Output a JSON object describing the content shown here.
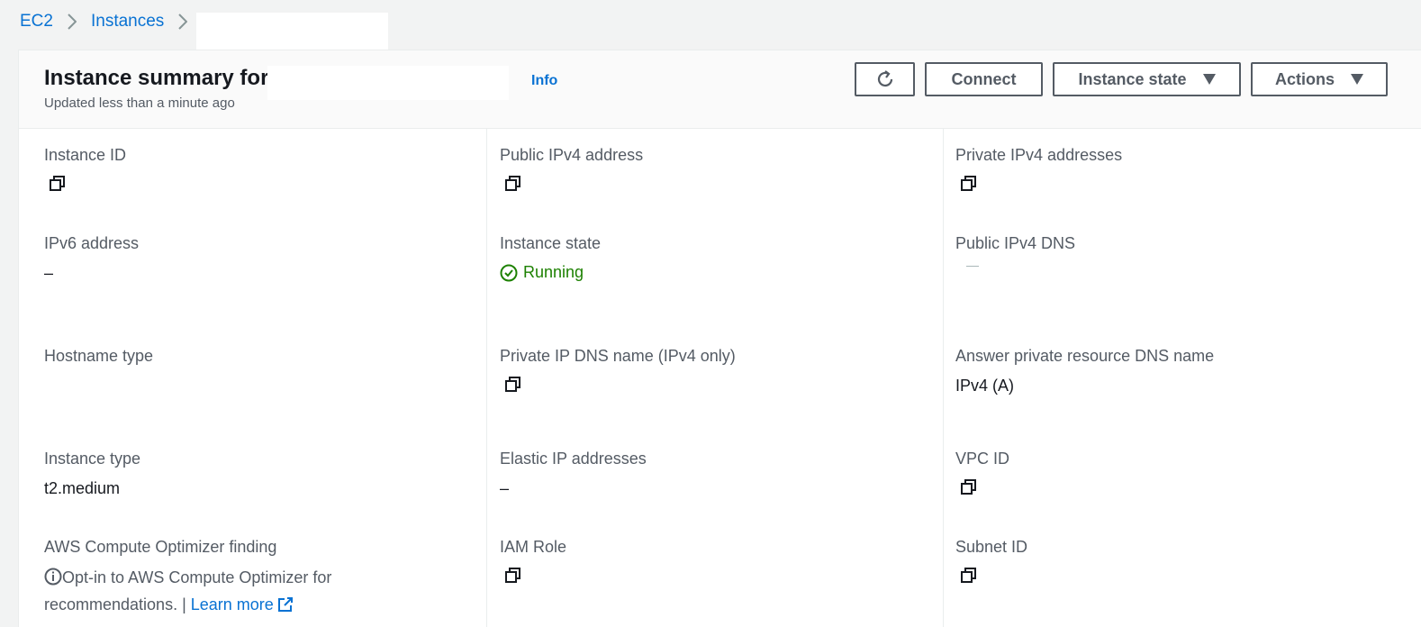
{
  "breadcrumb": {
    "items": [
      "EC2",
      "Instances"
    ]
  },
  "header": {
    "title": "Instance summary for",
    "info_label": "Info",
    "subtitle": "Updated less than a minute ago"
  },
  "toolbar": {
    "connect_label": "Connect",
    "instance_state_label": "Instance state",
    "actions_label": "Actions"
  },
  "fields": {
    "instance_id": {
      "label": "Instance ID"
    },
    "public_ipv4": {
      "label": "Public IPv4 address"
    },
    "private_ipv4": {
      "label": "Private IPv4 addresses"
    },
    "ipv6": {
      "label": "IPv6 address",
      "value": "–"
    },
    "instance_state": {
      "label": "Instance state",
      "value": "Running"
    },
    "public_dns": {
      "label": "Public IPv4 DNS"
    },
    "hostname_type": {
      "label": "Hostname type"
    },
    "private_dns": {
      "label": "Private IP DNS name (IPv4 only)"
    },
    "answer_dns": {
      "label": "Answer private resource DNS name",
      "value": "IPv4 (A)"
    },
    "instance_type": {
      "label": "Instance type",
      "value": "t2.medium"
    },
    "elastic_ip": {
      "label": "Elastic IP addresses",
      "value": "–"
    },
    "vpc_id": {
      "label": "VPC ID"
    },
    "optimizer": {
      "label": "AWS Compute Optimizer finding",
      "text": "Opt-in to AWS Compute Optimizer for recommendations. | ",
      "link": "Learn more"
    },
    "iam_role": {
      "label": "IAM Role"
    },
    "subnet_id": {
      "label": "Subnet ID"
    }
  },
  "colors": {
    "link": "#0972d3",
    "running": "#1d8102",
    "label": "#545b64"
  }
}
